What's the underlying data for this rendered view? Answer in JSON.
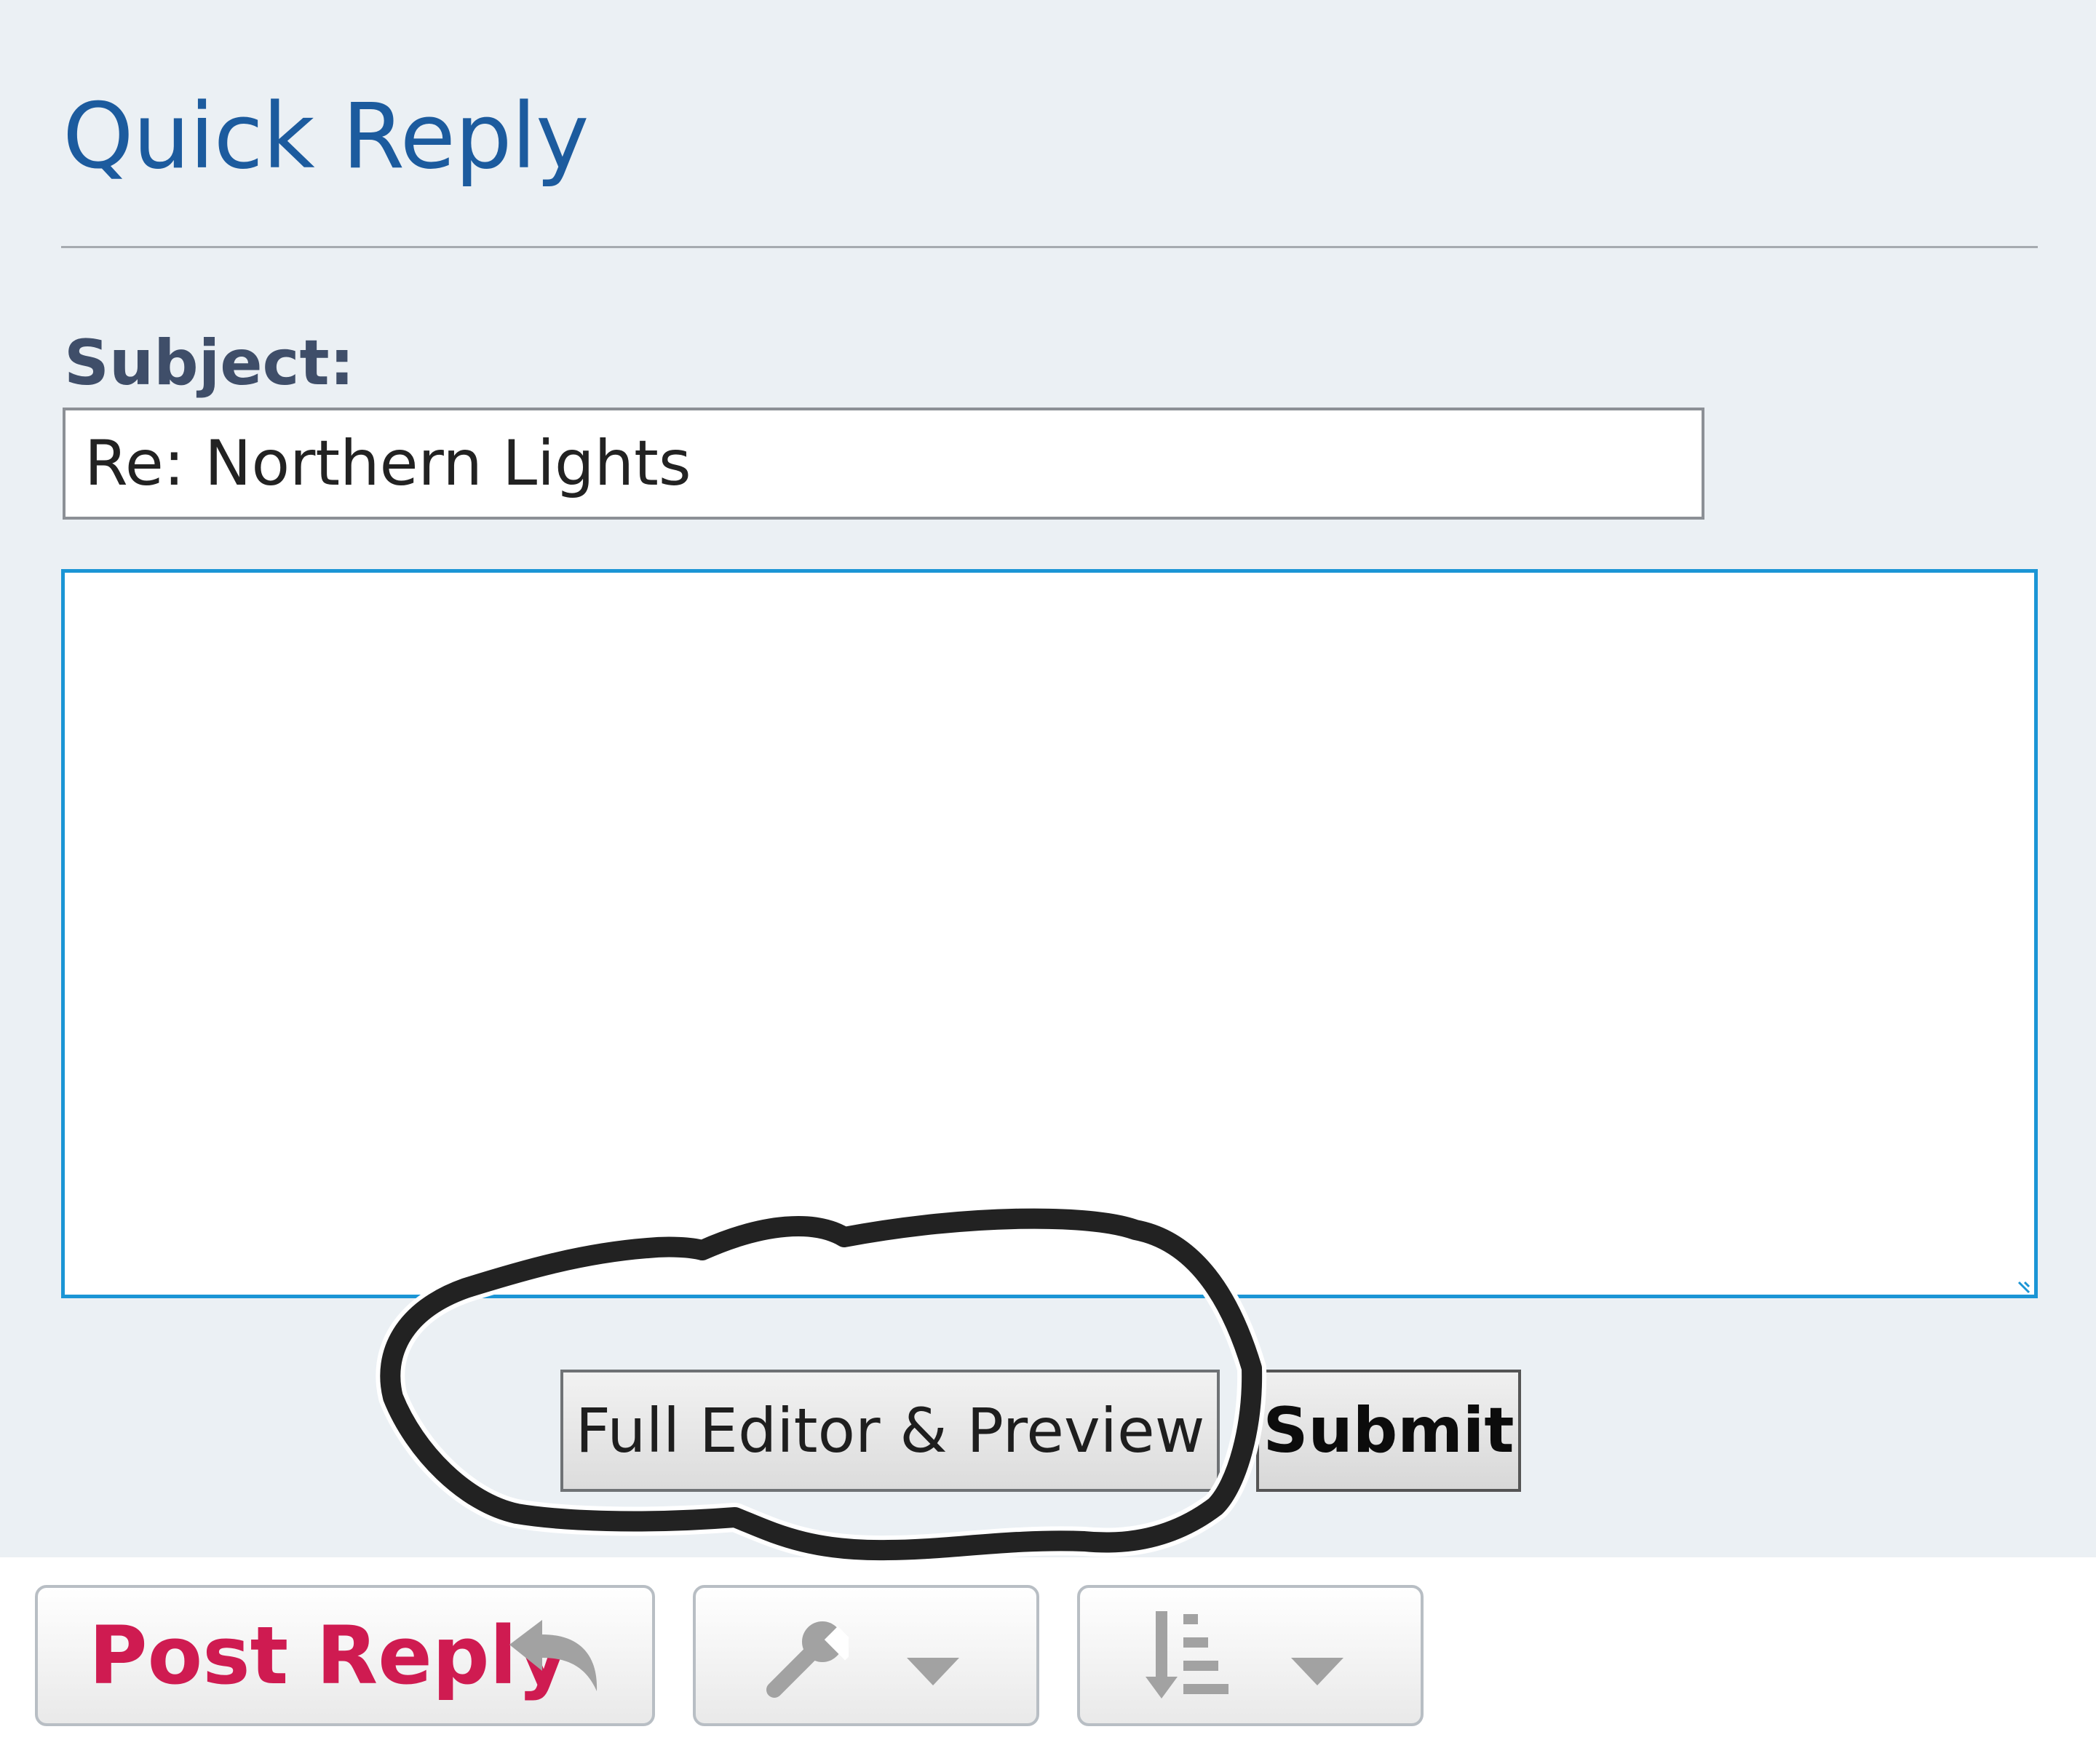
{
  "quick_reply": {
    "title": "Quick Reply",
    "subject_label": "Subject:",
    "subject_value": "Re: Northern Lights",
    "message_value": ""
  },
  "buttons": {
    "full_editor_label": "Full Editor & Preview",
    "submit_label": "Submit"
  },
  "actions": {
    "post_reply_label": "Post Reply",
    "post_reply_icon": "reply-arrow-icon",
    "tools_icon": "wrench-icon",
    "sort_icon": "sort-order-icon",
    "dropdown_icon": "caret-down-icon"
  },
  "colors": {
    "title": "#1c5b9e",
    "panel_background": "#ebf0f4",
    "textarea_focus_border": "#1b95d5",
    "post_reply": "#cf1b51",
    "annotation_ink": "#222222"
  }
}
